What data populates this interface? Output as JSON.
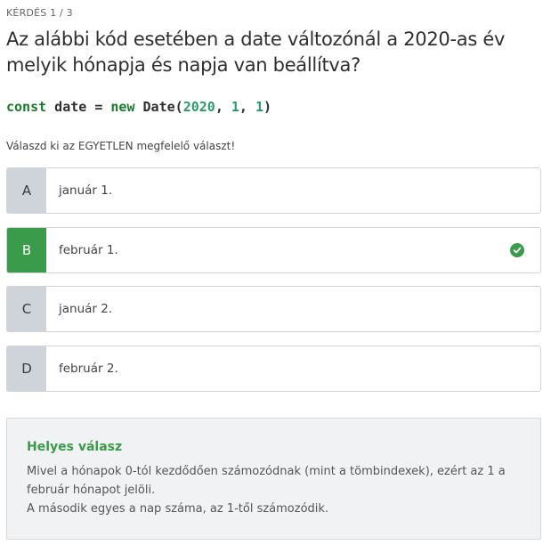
{
  "counter": "KÉRDÉS 1 / 3",
  "question": "Az alábbi kód esetében a date változónál a 2020-as év melyik hónapja és napja van beállítva?",
  "code": {
    "kw_const": "const",
    "var": " date = ",
    "kw_new": "new",
    "ctor": " Date(",
    "n1": "2020",
    "sep1": ", ",
    "n2": "1",
    "sep2": ", ",
    "n3": "1",
    "close": ")"
  },
  "instruction": "Válaszd ki az EGYETLEN megfelelő választ!",
  "options": [
    {
      "letter": "A",
      "text": "január 1."
    },
    {
      "letter": "B",
      "text": "február 1."
    },
    {
      "letter": "C",
      "text": "január 2."
    },
    {
      "letter": "D",
      "text": "február 2."
    }
  ],
  "correct_option": "B",
  "explanation": {
    "heading": "Helyes válasz",
    "line1": "Mivel a hónapok 0-tól kezdődően számozódnak (mint a tömbindexek), ezért az 1 a",
    "line2": "február hónapot jelöli.",
    "line3": "A második egyes a nap száma, az 1-től számozódik."
  },
  "colors": {
    "correct": "#3a9b4b",
    "letter_bg": "#cfd3da"
  }
}
